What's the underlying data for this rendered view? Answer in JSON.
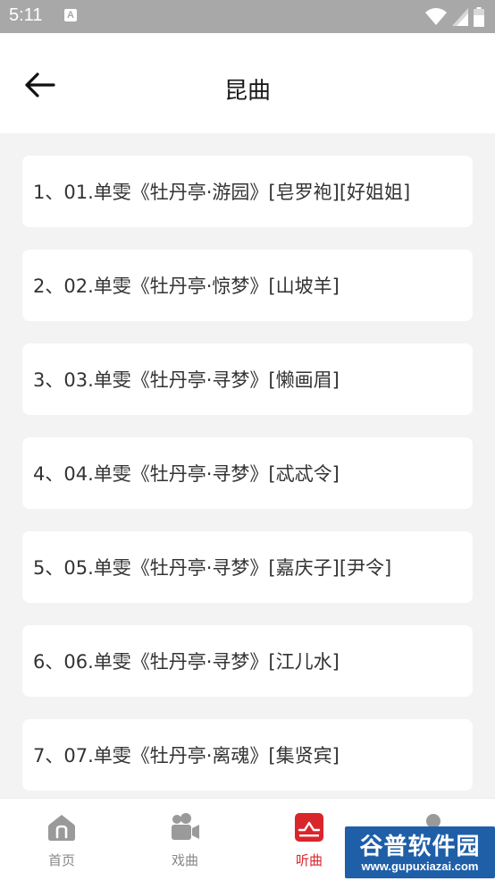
{
  "status_bar": {
    "time": "5:11",
    "notification_icon": "A",
    "icons": [
      "wifi-icon",
      "signal-icon",
      "battery-icon"
    ]
  },
  "header": {
    "back_icon": "arrow-left-icon",
    "title": "昆曲"
  },
  "list": {
    "items": [
      {
        "label": "1、01.单雯《牡丹亭·游园》[皂罗袍][好姐姐]"
      },
      {
        "label": "2、02.单雯《牡丹亭·惊梦》[山坡羊]"
      },
      {
        "label": "3、03.单雯《牡丹亭·寻梦》[懒画眉]"
      },
      {
        "label": "4、04.单雯《牡丹亭·寻梦》[忒忒令]"
      },
      {
        "label": "5、05.单雯《牡丹亭·寻梦》[嘉庆子][尹令]"
      },
      {
        "label": "6、06.单雯《牡丹亭·寻梦》[江儿水]"
      },
      {
        "label": "7、07.单雯《牡丹亭·离魂》[集贤宾]"
      }
    ]
  },
  "tabbar": {
    "tabs": [
      {
        "label": "首页",
        "icon": "home-icon"
      },
      {
        "label": "戏曲",
        "icon": "video-camera-icon"
      },
      {
        "label": "听曲",
        "icon": "audio-wave-icon",
        "active": true
      },
      {
        "label": "",
        "icon": "user-icon"
      }
    ]
  },
  "watermark": {
    "title": "谷普软件园",
    "url": "www.gupuxiazai.com"
  },
  "colors": {
    "status_bar": "#a8a8a8",
    "background": "#f3f3f3",
    "card": "#ffffff",
    "accent": "#d9262c",
    "tab_inactive": "#888888"
  }
}
